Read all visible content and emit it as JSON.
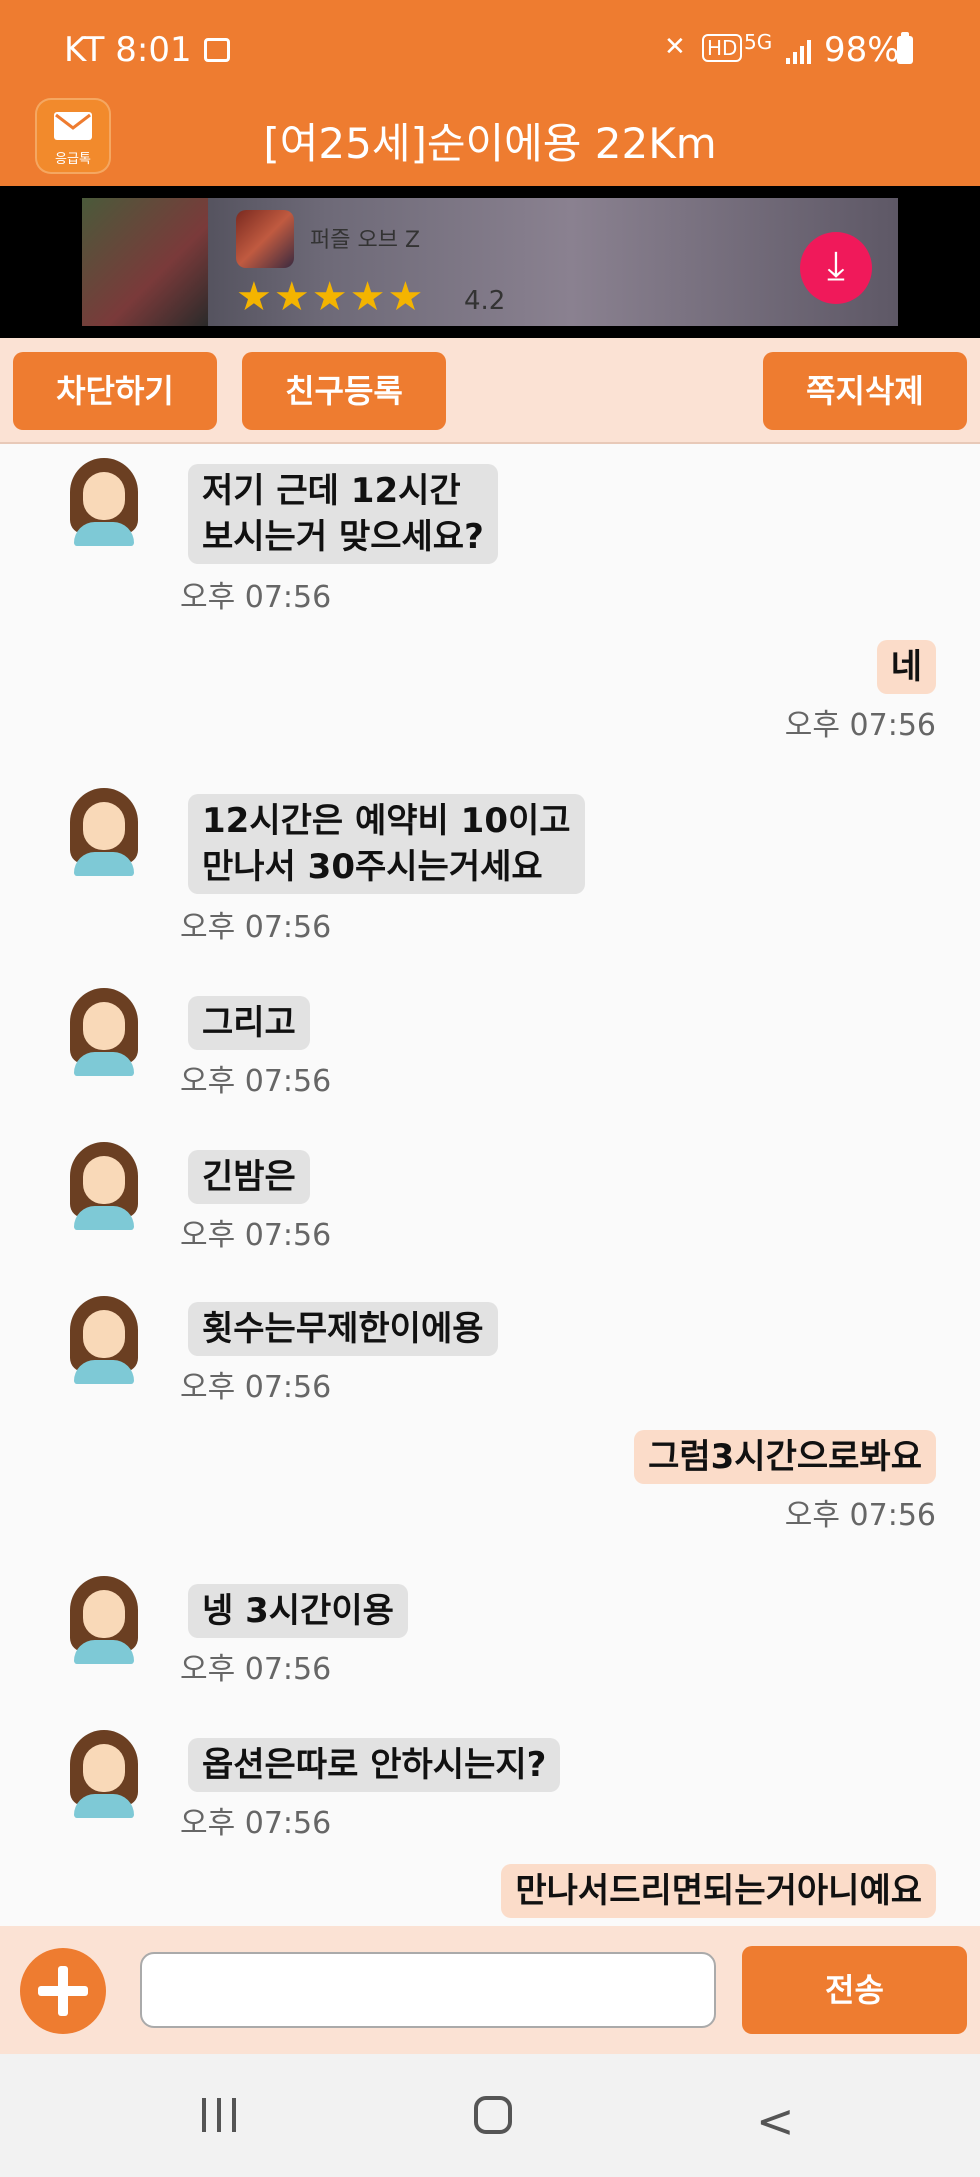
{
  "status_bar": {
    "carrier_time": "KT 8:01",
    "battery": "98%",
    "icons": [
      "gallery-icon",
      "mute-icon",
      "hd-icon",
      "5g-icon",
      "signal-icon",
      "battery-icon"
    ],
    "hd_label": "HD",
    "network_label": "5G"
  },
  "header": {
    "logo_text": "응급톡",
    "title": "[여25세]순이에용 22Km"
  },
  "ad": {
    "app_name": "퍼즐 오브 Z",
    "stars": "★★★★★",
    "rating": "4.2"
  },
  "actions": {
    "block": "차단하기",
    "add_friend": "친구등록",
    "delete_messages": "쪽지삭제"
  },
  "messages": [
    {
      "from": "other",
      "text": "저기 근데 12시간\n보시는거 맞으세요?",
      "time": "오후 07:56"
    },
    {
      "from": "me",
      "text": "네",
      "time": "오후 07:56"
    },
    {
      "from": "other",
      "text": "12시간은 예약비 10이고\n만나서 30주시는거세요",
      "time": "오후 07:56"
    },
    {
      "from": "other",
      "text": "그리고",
      "time": "오후 07:56"
    },
    {
      "from": "other",
      "text": "긴밤은",
      "time": "오후 07:56"
    },
    {
      "from": "other",
      "text": "횟수는무제한이에용",
      "time": "오후 07:56"
    },
    {
      "from": "me",
      "text": "그럼3시간으로봐요",
      "time": "오후 07:56"
    },
    {
      "from": "other",
      "text": "넹 3시간이용",
      "time": "오후 07:56"
    },
    {
      "from": "other",
      "text": "옵션은따로 안하시는지?",
      "time": "오후 07:56"
    },
    {
      "from": "me",
      "text": "만나서드리면되는거아니예요",
      "time": ""
    }
  ],
  "input": {
    "placeholder": "",
    "send_label": "전송"
  },
  "colors": {
    "accent": "#ee7c30",
    "light_bg": "#fbe2d4",
    "incoming_bubble": "#e2e2e2",
    "outgoing_bubble": "#fbdcc9"
  }
}
